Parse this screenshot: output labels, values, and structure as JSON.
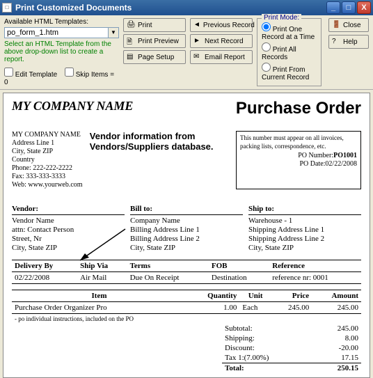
{
  "window": {
    "title": "Print Customized Documents"
  },
  "toolbar": {
    "templates_label": "Available HTML Templates:",
    "template_value": "po_form_1.htm",
    "hint": "Select an HTML Template from the above drop-down list to create a report.",
    "edit_template": "Edit Template",
    "skip_items": "Skip Items = 0",
    "buttons": {
      "print": "Print",
      "preview": "Print Preview",
      "page_setup": "Page Setup",
      "prev_record": "Previous Record",
      "next_record": "Next Record",
      "email_report": "Email Report"
    },
    "mode": {
      "legend": "Print Mode:",
      "one": "Print One Record at a Time",
      "all": "Print All Records",
      "current": "Print From Current Record"
    },
    "close": "Close",
    "help": "Help"
  },
  "doc": {
    "company": "MY COMPANY NAME",
    "title": "Purchase Order",
    "from": {
      "name": "MY COMPANY NAME",
      "a1": "Address Line 1",
      "a2": "City, State ZIP",
      "a3": "Country",
      "ph": "Phone: 222-222-2222",
      "fx": "Fax: 333-333-3333",
      "web": "Web: www.yourweb.com"
    },
    "annot": "Vendor information from Vendors/Suppliers database.",
    "numbox": {
      "note": "This number must appear on all invoices, packing lists, correspondence, etc.",
      "num_label": "PO Number:",
      "num": "PO1001",
      "date_label": "PO Date:",
      "date": "02/22/2008"
    },
    "vendor": {
      "h": "Vendor:",
      "l1": "Vendor Name",
      "l2": "attn: Contact Person",
      "l3": "Street, Nr",
      "l4": "City, State ZIP"
    },
    "bill": {
      "h": "Bill to:",
      "l1": "Company Name",
      "l2": "Billing Address Line 1",
      "l3": "Billing Address Line 2",
      "l4": "City, State ZIP"
    },
    "ship": {
      "h": "Ship to:",
      "l1": "Warehouse - 1",
      "l2": "Shipping Address Line 1",
      "l3": "Shipping Address Line 2",
      "l4": "City, State ZIP"
    },
    "grid": {
      "h": [
        "Delivery By",
        "Ship Via",
        "Terms",
        "FOB",
        "Reference"
      ],
      "r": [
        "02/22/2008",
        "Air Mail",
        "Due On Receipt",
        "Destination",
        "reference nr: 0001"
      ]
    },
    "items": {
      "h": [
        "Item",
        "Quantity",
        "Unit",
        "Price",
        "Amount"
      ],
      "rows": [
        {
          "item": "Purchase Order Organizer Pro",
          "qty": "1.00",
          "unit": "Each",
          "price": "245.00",
          "amt": "245.00"
        }
      ],
      "note": "- po individual instructions, included on the PO"
    },
    "totals": {
      "subtotal_l": "Subtotal:",
      "subtotal": "245.00",
      "shipping_l": "Shipping:",
      "shipping": "8.00",
      "discount_l": "Discount:",
      "discount": "-20.00",
      "tax_l": "Tax 1:(7.00%)",
      "tax": "17.15",
      "total_l": "Total:",
      "total": "250.15"
    }
  }
}
